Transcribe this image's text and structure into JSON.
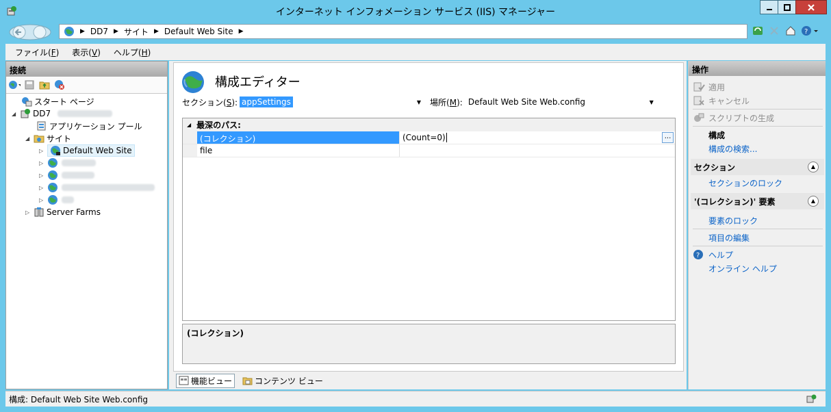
{
  "window": {
    "title": "インターネット インフォメーション サービス (IIS) マネージャー"
  },
  "address": {
    "crumbs": [
      "DD7",
      "サイト",
      "Default Web Site"
    ]
  },
  "menu": [
    {
      "text": "ファイル(",
      "key": "F",
      "tail": ")"
    },
    {
      "text": "表示(",
      "key": "V",
      "tail": ")"
    },
    {
      "text": "ヘルプ(",
      "key": "H",
      "tail": ")"
    }
  ],
  "connections": {
    "header": "接続",
    "tree": {
      "start_page": "スタート ページ",
      "server": "DD7",
      "app_pools": "アプリケーション プール",
      "sites": "サイト",
      "default_site": "Default Web Site",
      "server_farms": "Server Farms"
    }
  },
  "editor": {
    "title": "構成エディター",
    "section_label_pre": "セクション(",
    "section_label_key": "S",
    "section_label_post": "):",
    "section_value": "appSettings",
    "from_label_pre": "場所(",
    "from_label_key": "M",
    "from_label_post": "):",
    "from_value": "Default Web Site Web.config",
    "grid": {
      "category": "最深のパス:",
      "rows": [
        {
          "key": "(コレクション)",
          "value": "(Count=0)"
        },
        {
          "key": "file",
          "value": ""
        }
      ],
      "ellipsis": "..."
    },
    "description": "(コレクション)",
    "tabs": {
      "features": "機能ビュー",
      "content": "コンテンツ ビュー"
    }
  },
  "actions": {
    "header": "操作",
    "apply": "適用",
    "cancel": "キャンセル",
    "generate_script": "スクリプトの生成",
    "configuration": "構成",
    "search_config": "構成の検索...",
    "section_header": "セクション",
    "lock_section": "セクションのロック",
    "collection_header": "'(コレクション)' 要素",
    "lock_element": "要素のロック",
    "edit_items": "項目の編集",
    "help": "ヘルプ",
    "online_help": "オンライン ヘルプ"
  },
  "status": {
    "text": "構成: Default Web Site Web.config"
  }
}
